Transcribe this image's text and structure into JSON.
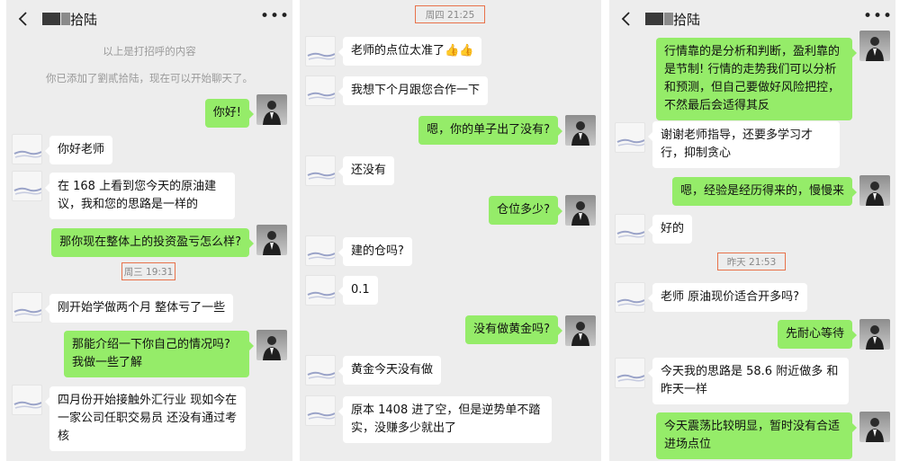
{
  "panels": [
    {
      "title": "拾陆",
      "system_notes": [
        "以上是打招呼的内容",
        "你已添加了劉貳拾陆，现在可以开始聊天了。"
      ],
      "messages": [
        {
          "side": "out",
          "text": "你好!"
        },
        {
          "side": "in",
          "text": "你好老师"
        },
        {
          "side": "in",
          "text": "在 168 上看到您今天的原油建议，我和您的思路是一样的"
        },
        {
          "side": "out",
          "text": "那你现在整体上的投资盈亏怎么样?"
        },
        {
          "side": "time",
          "text": "周三 19:31"
        },
        {
          "side": "in",
          "text": "刚开始学做两个月  整体亏了一些"
        },
        {
          "side": "out",
          "text": "那能介绍一下你自己的情况吗? 我做一些了解"
        },
        {
          "side": "in",
          "text": "四月份开始接触外汇行业  现如今在一家公司任职交易员  还没有通过考核"
        }
      ]
    },
    {
      "messages": [
        {
          "side": "time",
          "text": "周四 21:25"
        },
        {
          "side": "in",
          "text": "老师的点位太准了👍👍"
        },
        {
          "side": "in",
          "text": "我想下个月跟您合作一下"
        },
        {
          "side": "out",
          "text": "嗯，你的单子出了没有?"
        },
        {
          "side": "in",
          "text": "还没有"
        },
        {
          "side": "out",
          "text": "仓位多少?"
        },
        {
          "side": "in",
          "text": "建的仓吗?"
        },
        {
          "side": "in",
          "text": "0.1"
        },
        {
          "side": "out",
          "text": "没有做黄金吗?"
        },
        {
          "side": "in",
          "text": "黄金今天没有做"
        },
        {
          "side": "in",
          "text": "原本 1408 进了空，但是逆势单不踏实，没赚多少就出了"
        }
      ]
    },
    {
      "title": "拾陆",
      "messages": [
        {
          "side": "out",
          "text": "行情靠的是分析和判断，盈利靠的是节制! 行情的走势我们可以分析和预测，但自己要做好风险把控，不然最后会适得其反"
        },
        {
          "side": "in",
          "text": "谢谢老师指导，还要多学习才行，抑制贪心"
        },
        {
          "side": "out",
          "text": "嗯，经验是经历得来的，慢慢来"
        },
        {
          "side": "in",
          "text": "好的"
        },
        {
          "side": "time",
          "text": "昨天 21:53"
        },
        {
          "side": "in",
          "text": "老师  原油现价适合开多吗?"
        },
        {
          "side": "out",
          "text": "先耐心等待"
        },
        {
          "side": "in",
          "text": "今天我的思路是 58.6 附近做多  和昨天一样"
        },
        {
          "side": "out",
          "text": "今天震荡比较明显，暂时没有合适进场点位"
        }
      ]
    }
  ],
  "icons": {
    "back": "chevron-left-icon",
    "more": "more-dots-icon"
  },
  "colors": {
    "background": "#ededed",
    "outgoing_bubble": "#95ec69",
    "incoming_bubble": "#ffffff",
    "time_highlight_border": "#e8724a"
  }
}
